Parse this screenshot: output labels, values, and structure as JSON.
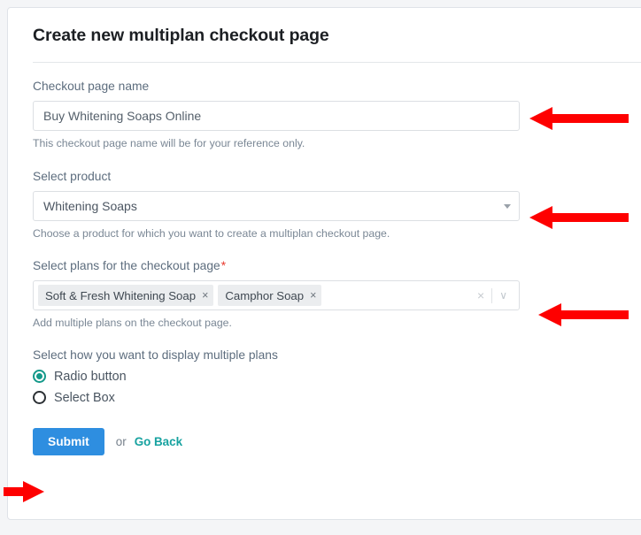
{
  "page": {
    "title": "Create new multiplan checkout page"
  },
  "form": {
    "checkout_name": {
      "label": "Checkout page name",
      "value": "Buy Whitening Soaps Online",
      "placeholder": "Checkout page name",
      "help": "This checkout page name will be for your reference only."
    },
    "product": {
      "label": "Select product",
      "value": "Whitening Soaps",
      "help": "Choose a product for which you want to create a multiplan checkout page.",
      "caret_icon": "chevron-down-icon"
    },
    "plans": {
      "label": "Select plans for the checkout page",
      "required_marker": "*",
      "tags": [
        {
          "label": "Soft & Fresh Whitening Soap",
          "remove_icon": "close-icon",
          "remove_glyph": "×"
        },
        {
          "label": "Camphor Soap",
          "remove_icon": "close-icon",
          "remove_glyph": "×"
        }
      ],
      "clear_all_glyph": "×",
      "caret_glyph": "∨",
      "help": "Add multiple plans on the checkout page."
    },
    "display_mode": {
      "label": "Select how you want to display multiple plans",
      "options": [
        {
          "label": "Radio button",
          "selected": true
        },
        {
          "label": "Select Box",
          "selected": false
        }
      ]
    }
  },
  "footer": {
    "submit_label": "Submit",
    "or_label": "or",
    "go_back_label": "Go Back"
  },
  "annotations": {
    "arrows": [
      {
        "name": "arrow-checkout-name",
        "direction": "left"
      },
      {
        "name": "arrow-select-product",
        "direction": "left"
      },
      {
        "name": "arrow-select-plans",
        "direction": "left"
      },
      {
        "name": "arrow-submit",
        "direction": "right"
      }
    ]
  },
  "colors": {
    "accent_blue": "#2e8ee0",
    "accent_teal": "#14998a",
    "link_teal": "#17a2a0",
    "required_red": "#e8392e",
    "annotation_red": "#fe0000"
  }
}
